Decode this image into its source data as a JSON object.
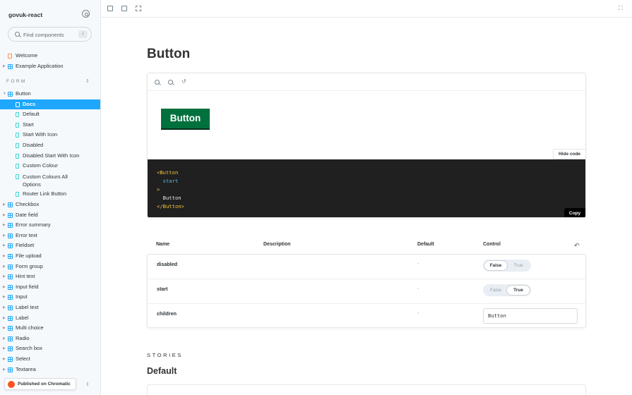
{
  "sidebar": {
    "brand": "govuk-react",
    "search": {
      "placeholder": "Find components",
      "shortcut": "/"
    },
    "top_items": [
      {
        "label": "Welcome",
        "icon": "document-icon"
      },
      {
        "label": "Example Application",
        "icon": "component-icon"
      }
    ],
    "group_label": "FORM",
    "button_component": "Button",
    "button_stories": [
      "Docs",
      "Default",
      "Start",
      "Start With Icon",
      "Disabled",
      "Disabled Start With Icon",
      "Custom Colour",
      "Custom Colours All Options",
      "Router Link Button"
    ],
    "components": [
      "Checkbox",
      "Date field",
      "Error summary",
      "Error text",
      "Fieldset",
      "File upload",
      "Form group",
      "Hint text",
      "Input field",
      "Input",
      "Label text",
      "Label",
      "Multi choice",
      "Radio",
      "Search box",
      "Select",
      "Textarea"
    ],
    "active_item": "Docs",
    "chromatic": "Published on Chromatic"
  },
  "main": {
    "title": "Button",
    "preview": {
      "button_label": "Button",
      "hide_code_label": "Hide code",
      "copy_label": "Copy",
      "code_lines": [
        "<Button",
        "  start",
        ">",
        "  Button",
        "</Button>"
      ]
    },
    "args_table": {
      "headers": {
        "name": "Name",
        "description": "Description",
        "default": "Default",
        "control": "Control"
      },
      "rows": [
        {
          "name": "disabled",
          "default": "-",
          "control": {
            "type": "boolean",
            "options": [
              "False",
              "True"
            ],
            "selected": "False"
          }
        },
        {
          "name": "start",
          "default": "-",
          "control": {
            "type": "boolean",
            "options": [
              "False",
              "True"
            ],
            "selected": "True"
          }
        },
        {
          "name": "children",
          "default": "-",
          "control": {
            "type": "text",
            "value": "Button"
          }
        }
      ]
    },
    "stories_heading": "STORIES",
    "story_title": "Default"
  },
  "colors": {
    "accent": "#1ea7fd",
    "govuk_green": "#00703c",
    "code_bg": "#202020",
    "chromatic": "#fc521f"
  }
}
